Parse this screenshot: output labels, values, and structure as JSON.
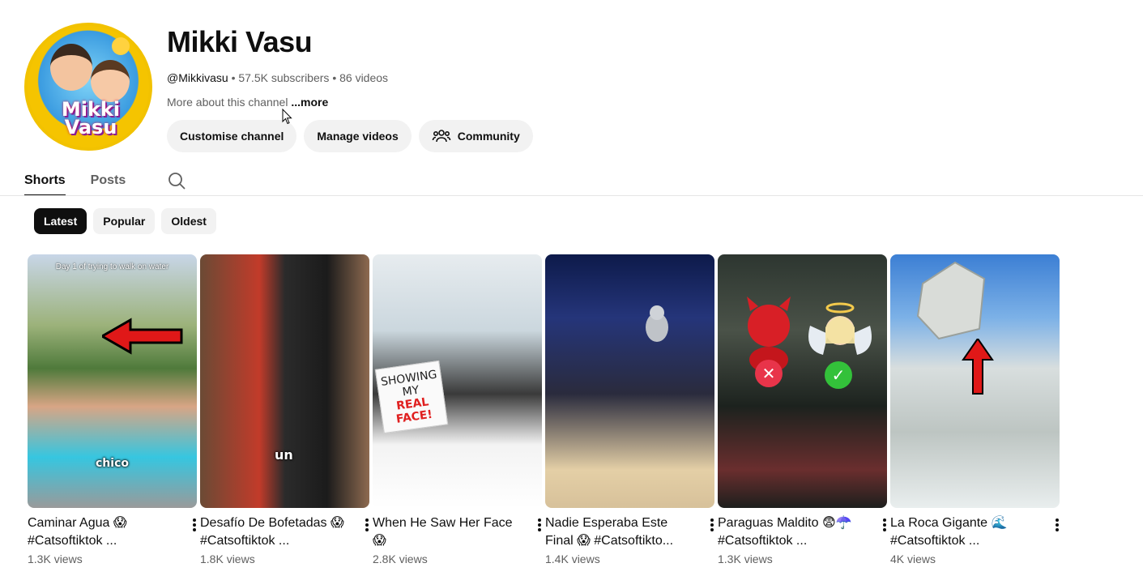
{
  "channel": {
    "name": "Mikki Vasu",
    "avatar_text": "Mikki Vasu",
    "handle": "@Mikkivasu",
    "subscribers": "57.5K subscribers",
    "videos": "86 videos",
    "about": "More about this channel",
    "more_label": "...more",
    "separator": "•"
  },
  "actions": {
    "customise": "Customise channel",
    "manage": "Manage videos",
    "community": "Community"
  },
  "tabs": [
    {
      "label": "Shorts",
      "active": true
    },
    {
      "label": "Posts",
      "active": false
    }
  ],
  "chips": [
    {
      "label": "Latest",
      "active": true
    },
    {
      "label": "Popular",
      "active": false
    },
    {
      "label": "Oldest",
      "active": false
    }
  ],
  "shorts": [
    {
      "title": "Caminar Agua 😱 #Catsoftiktok ...",
      "views": "1.3K views",
      "overlay_top": "Day 1 of trying to walk on water",
      "overlay": "chico"
    },
    {
      "title": "Desafío De Bofetadas 😱 #Catsoftiktok ...",
      "views": "1.8K views",
      "overlay": "un"
    },
    {
      "title": "When He Saw Her Face 😱",
      "views": "2.8K views",
      "sign": "SHOWING MY",
      "sign_red": "REAL FACE!"
    },
    {
      "title": "Nadie Esperaba Este Final 😱 #Catsoftikto...",
      "views": "1.4K views"
    },
    {
      "title": "Paraguas Maldito 😨☂️ #Catsoftiktok ...",
      "views": "1.3K views"
    },
    {
      "title": "La Roca Gigante 🌊 #Catsoftiktok ...",
      "views": "4K views"
    }
  ],
  "colors": {
    "accent": "#0f0f0f",
    "secondary_text": "#606060",
    "chip_bg": "#f2f2f2"
  }
}
